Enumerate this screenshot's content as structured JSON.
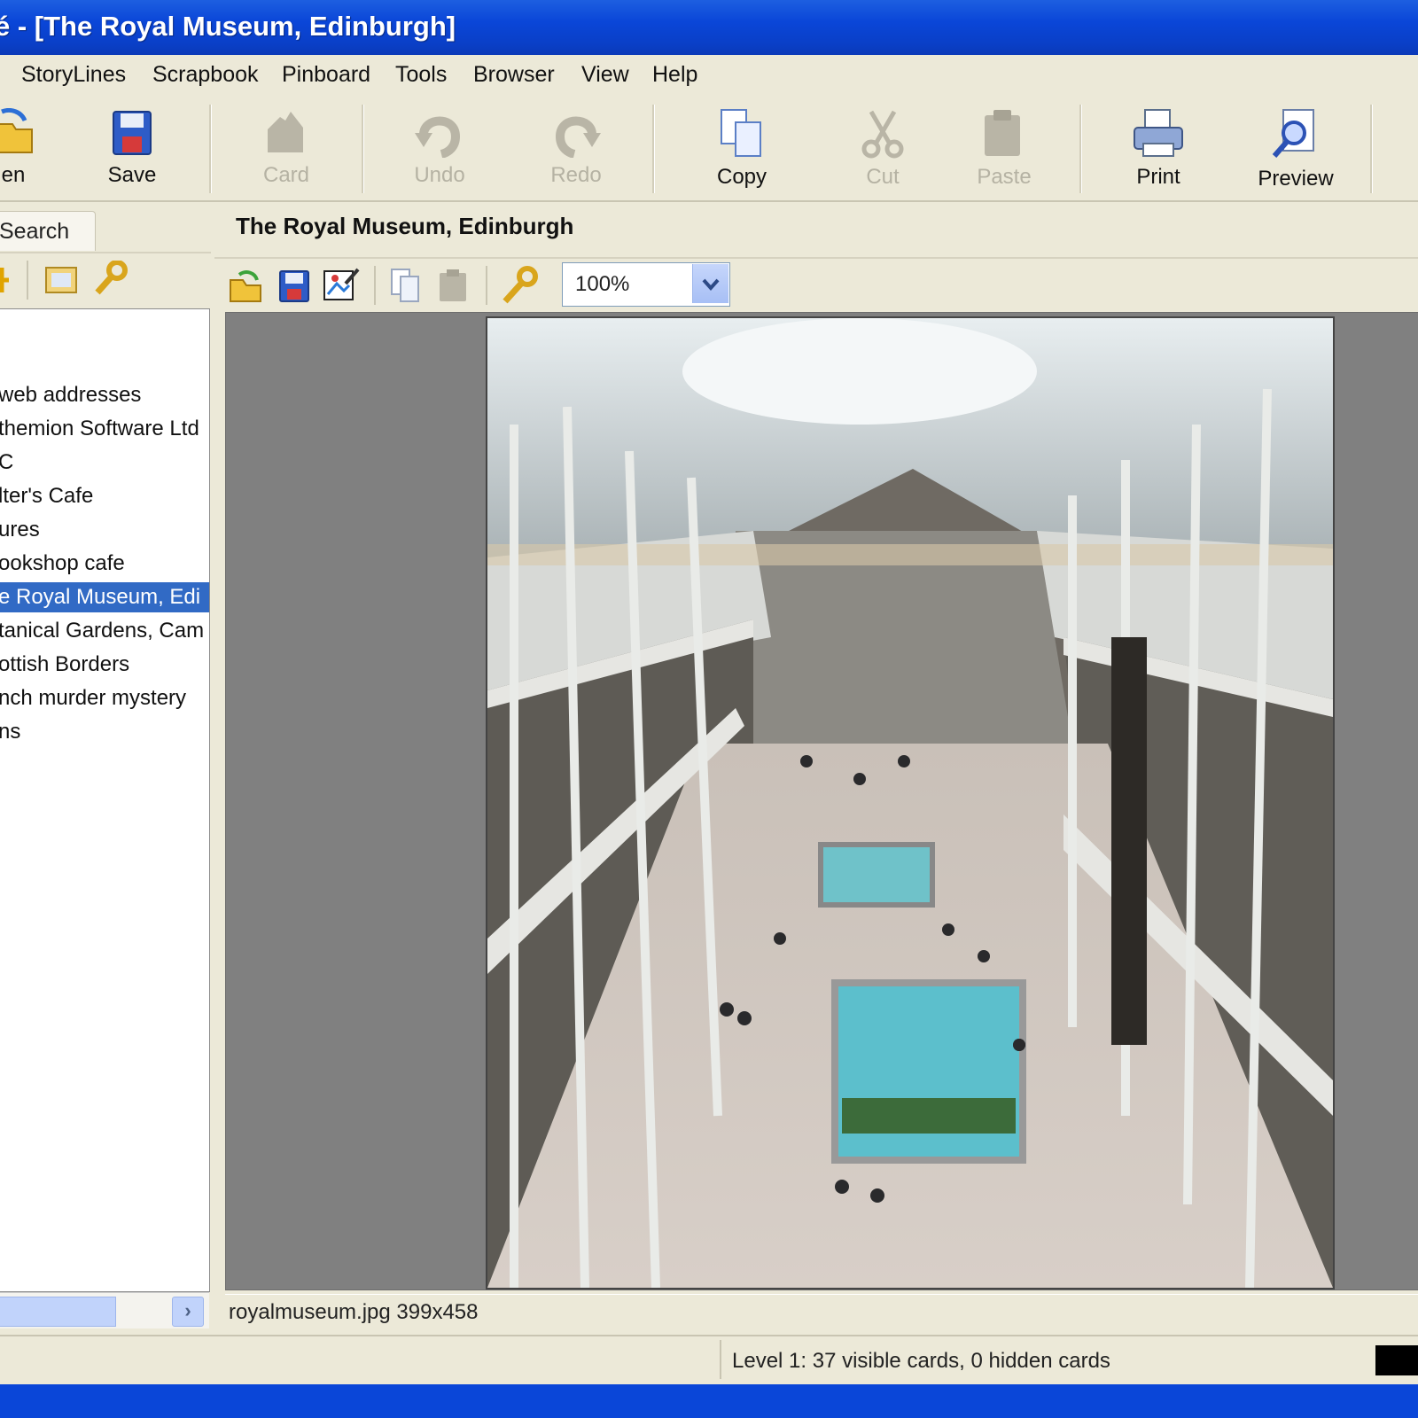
{
  "window": {
    "title": "é - [The Royal Museum, Edinburgh]"
  },
  "menu": {
    "items": [
      "StoryLines",
      "Scrapbook",
      "Pinboard",
      "Tools",
      "Browser",
      "View",
      "Help"
    ]
  },
  "toolbar": {
    "open": "en",
    "save": "Save",
    "card": "Card",
    "undo": "Undo",
    "redo": "Redo",
    "copy": "Copy",
    "cut": "Cut",
    "paste": "Paste",
    "print": "Print",
    "preview": "Preview"
  },
  "left_panel": {
    "tab": "Search",
    "items": [
      {
        "label": "web addresses",
        "selected": false
      },
      {
        "label": "themion Software Ltd",
        "selected": false
      },
      {
        "label": "C",
        "selected": false
      },
      {
        "label": "lter's Cafe",
        "selected": false
      },
      {
        "label": "ures",
        "selected": false
      },
      {
        "label": "ookshop cafe",
        "selected": false
      },
      {
        "label": "e Royal Museum, Edi",
        "selected": true
      },
      {
        "label": "tanical Gardens, Cam",
        "selected": false
      },
      {
        "label": "ottish Borders",
        "selected": false
      },
      {
        "label": "nch murder mystery",
        "selected": false
      },
      {
        "label": "ns",
        "selected": false
      }
    ],
    "scroll_arrow": "›"
  },
  "card": {
    "title": "The Royal Museum, Edinburgh",
    "zoom": "100%",
    "file_info": "royalmuseum.jpg 399x458"
  },
  "status": {
    "text": "Level 1: 37 visible cards, 0 hidden cards"
  },
  "colors": {
    "titlebar": "#0a46d8",
    "selection": "#316ac5",
    "viewer_bg": "#808080"
  }
}
